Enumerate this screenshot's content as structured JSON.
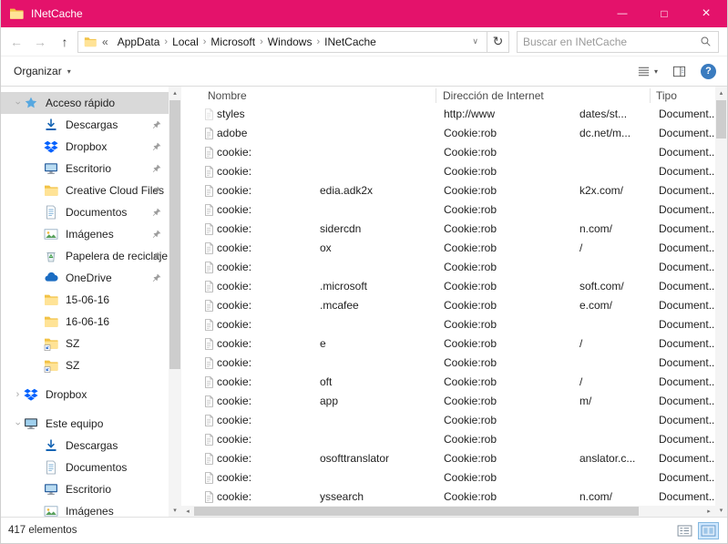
{
  "window": {
    "accent_color": "#e4126b"
  },
  "titlebar": {
    "title": "INetCache",
    "minimize_glyph": "—",
    "maximize_glyph": "□",
    "close_glyph": "×"
  },
  "navbar": {
    "back_glyph": "←",
    "forward_glyph": "→",
    "up_glyph": "↑",
    "overflow_glyph": "«",
    "separator_glyph": "›",
    "breadcrumb": [
      "AppData",
      "Local",
      "Microsoft",
      "Windows",
      "INetCache"
    ],
    "address_dropdown_glyph": "∨",
    "refresh_glyph": "↻",
    "search_placeholder": "Buscar en INetCache"
  },
  "toolbar": {
    "organize_label": "Organizar",
    "caret_glyph": "▾",
    "help_glyph": "?"
  },
  "scrollbar": {
    "up_glyph": "▴",
    "down_glyph": "▾",
    "left_glyph": "◂",
    "right_glyph": "▸"
  },
  "sidebar": {
    "items": [
      {
        "label": "Acceso rápido",
        "icon": "star",
        "level": 0,
        "chevron": "expanded",
        "selected": true
      },
      {
        "label": "Descargas",
        "icon": "downloads",
        "level": 1,
        "pinned": true
      },
      {
        "label": "Dropbox",
        "icon": "dropbox",
        "level": 1,
        "pinned": true
      },
      {
        "label": "Escritorio",
        "icon": "monitor",
        "level": 1,
        "pinned": true
      },
      {
        "label": "Creative Cloud Files",
        "icon": "folder",
        "level": 1,
        "pinned": true
      },
      {
        "label": "Documentos",
        "icon": "document",
        "level": 1,
        "pinned": true
      },
      {
        "label": "Imágenes",
        "icon": "pictures",
        "level": 1,
        "pinned": true
      },
      {
        "label": "Papelera de reciclaje",
        "icon": "recycle",
        "level": 1,
        "pinned": true
      },
      {
        "label": "OneDrive",
        "icon": "cloud",
        "level": 1,
        "pinned": true
      },
      {
        "label": "15-06-16",
        "icon": "folder",
        "level": 1
      },
      {
        "label": "16-06-16",
        "icon": "folder",
        "level": 1
      },
      {
        "label": "SZ",
        "icon": "folder-link",
        "level": 1
      },
      {
        "label": "SZ",
        "icon": "folder-link",
        "level": 1
      },
      {
        "label": "Dropbox",
        "icon": "dropbox",
        "level": 0,
        "chevron": "collapsed",
        "gap_before": true
      },
      {
        "label": "Este equipo",
        "icon": "computer",
        "level": 0,
        "chevron": "expanded",
        "gap_before": true
      },
      {
        "label": "Descargas",
        "icon": "downloads",
        "level": 1
      },
      {
        "label": "Documentos",
        "icon": "document",
        "level": 1
      },
      {
        "label": "Escritorio",
        "icon": "monitor",
        "level": 1
      },
      {
        "label": "Imágenes",
        "icon": "pictures",
        "level": 1
      }
    ]
  },
  "filelist": {
    "columns": [
      "Nombre",
      "Dirección de Internet",
      "Tipo"
    ],
    "rows": [
      {
        "icon": "page-muted",
        "name": "styles",
        "name2": "",
        "addr": "http://www",
        "addr2": "dates/st...",
        "tipo": "Document..."
      },
      {
        "icon": "page",
        "name": "adobe",
        "name2": "",
        "addr": "Cookie:rob",
        "addr2": "dc.net/m...",
        "tipo": "Document..."
      },
      {
        "icon": "page",
        "name": "cookie:",
        "name2": "",
        "addr": "Cookie:rob",
        "addr2": "",
        "tipo": "Document..."
      },
      {
        "icon": "page",
        "name": "cookie:",
        "name2": "",
        "addr": "Cookie:rob",
        "addr2": "",
        "tipo": "Document..."
      },
      {
        "icon": "page",
        "name": "cookie:",
        "name2": "edia.adk2x",
        "addr": "Cookie:rob",
        "addr2": "k2x.com/",
        "tipo": "Document..."
      },
      {
        "icon": "page",
        "name": "cookie:",
        "name2": "",
        "addr": "Cookie:rob",
        "addr2": "",
        "tipo": "Document..."
      },
      {
        "icon": "page",
        "name": "cookie:",
        "name2": "sidercdn",
        "addr": "Cookie:rob",
        "addr2": "n.com/",
        "tipo": "Document..."
      },
      {
        "icon": "page",
        "name": "cookie:",
        "name2": "ox",
        "addr": "Cookie:rob",
        "addr2": "/",
        "tipo": "Document..."
      },
      {
        "icon": "page",
        "name": "cookie:",
        "name2": "",
        "addr": "Cookie:rob",
        "addr2": "",
        "tipo": "Document..."
      },
      {
        "icon": "page",
        "name": "cookie:",
        "name2": ".microsoft",
        "addr": "Cookie:rob",
        "addr2": "soft.com/",
        "tipo": "Document..."
      },
      {
        "icon": "page",
        "name": "cookie:",
        "name2": ".mcafee",
        "addr": "Cookie:rob",
        "addr2": "e.com/",
        "tipo": "Document..."
      },
      {
        "icon": "page",
        "name": "cookie:",
        "name2": "",
        "addr": "Cookie:rob",
        "addr2": "",
        "tipo": "Document..."
      },
      {
        "icon": "page",
        "name": "cookie:",
        "name2": "e",
        "addr": "Cookie:rob",
        "addr2": "/",
        "tipo": "Document..."
      },
      {
        "icon": "page",
        "name": "cookie:",
        "name2": "",
        "addr": "Cookie:rob",
        "addr2": "",
        "tipo": "Document..."
      },
      {
        "icon": "page",
        "name": "cookie:",
        "name2": "oft",
        "addr": "Cookie:rob",
        "addr2": "/",
        "tipo": "Document..."
      },
      {
        "icon": "page",
        "name": "cookie:",
        "name2": "app",
        "addr": "Cookie:rob",
        "addr2": "m/",
        "tipo": "Document..."
      },
      {
        "icon": "page",
        "name": "cookie:",
        "name2": "",
        "addr": "Cookie:rob",
        "addr2": "",
        "tipo": "Document..."
      },
      {
        "icon": "page",
        "name": "cookie:",
        "name2": "",
        "addr": "Cookie:rob",
        "addr2": "",
        "tipo": "Document..."
      },
      {
        "icon": "page",
        "name": "cookie:",
        "name2": "osofttranslator",
        "addr": "Cookie:rob",
        "addr2": "anslator.c...",
        "tipo": "Document..."
      },
      {
        "icon": "page",
        "name": "cookie:",
        "name2": "",
        "addr": "Cookie:rob",
        "addr2": "",
        "tipo": "Document..."
      },
      {
        "icon": "page",
        "name": "cookie:",
        "name2": "yssearch",
        "addr": "Cookie:rob",
        "addr2": "n.com/",
        "tipo": "Document..."
      }
    ]
  },
  "statusbar": {
    "count_label": "417 elementos"
  }
}
